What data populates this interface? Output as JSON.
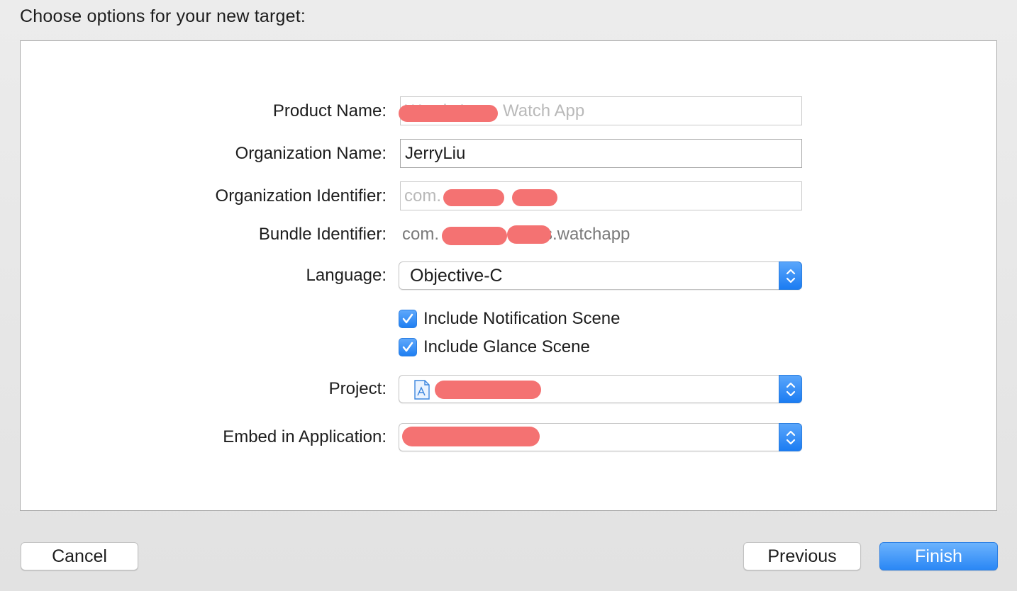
{
  "sheet": {
    "title": "Choose options for your new target:"
  },
  "form": {
    "product_name": {
      "label": "Product Name:",
      "value": "Watch App"
    },
    "organization_name": {
      "label": "Organization Name:",
      "value": "JerryLiu"
    },
    "organization_identifier": {
      "label": "Organization Identifier:",
      "value": "com."
    },
    "bundle_identifier": {
      "label": "Bundle Identifier:",
      "prefix": "com.",
      "suffix": "s.watchapp"
    },
    "language": {
      "label": "Language:",
      "value": "Objective-C"
    },
    "include_notification_scene": {
      "label": "Include Notification Scene",
      "checked": true
    },
    "include_glance_scene": {
      "label": "Include Glance Scene",
      "checked": true
    },
    "project": {
      "label": "Project:",
      "icon": "xcode-project-document-icon"
    },
    "embed_in_application": {
      "label": "Embed in Application:"
    }
  },
  "buttons": {
    "cancel": "Cancel",
    "previous": "Previous",
    "finish": "Finish"
  },
  "colors": {
    "accent": "#1f7ff2",
    "redaction": "#f47272"
  }
}
